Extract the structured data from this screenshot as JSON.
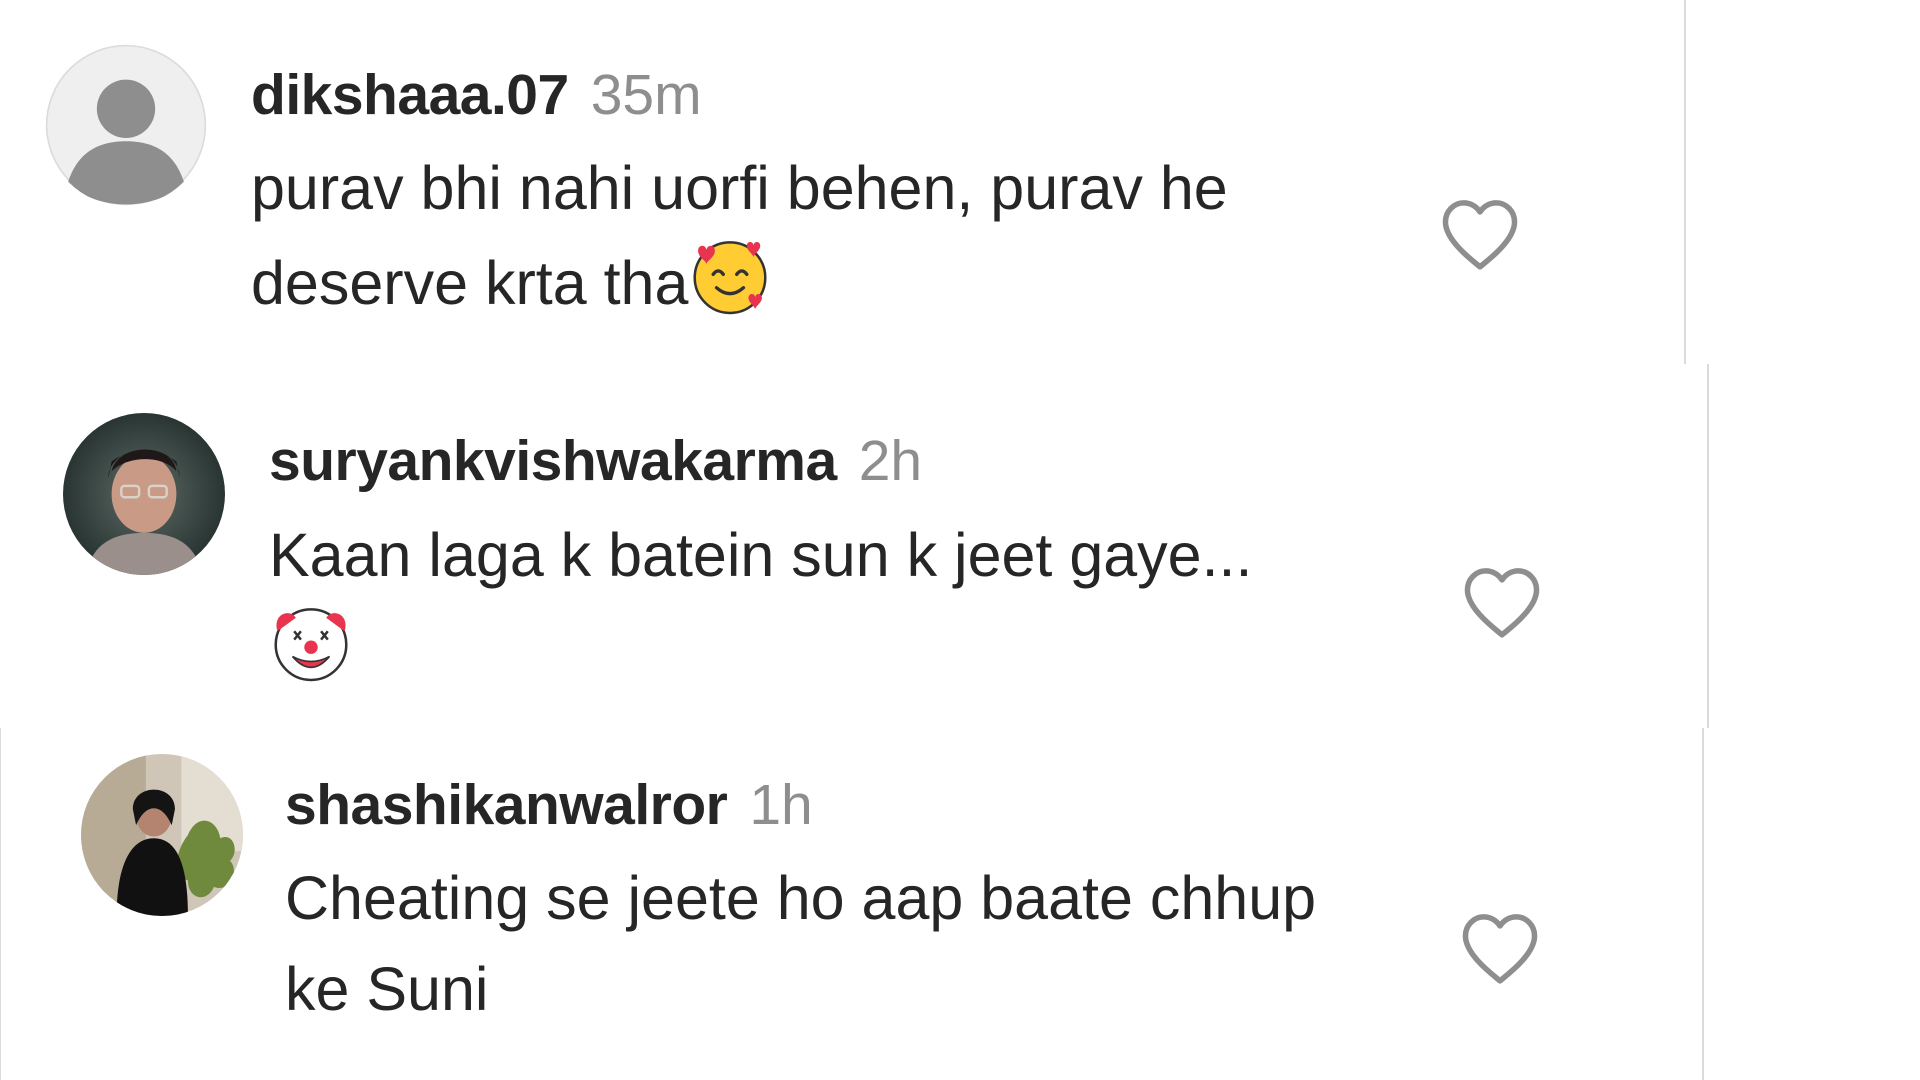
{
  "comments": [
    {
      "username": "dikshaaa.07",
      "time": "35m",
      "text": "purav bhi nahi uorfi behen, purav he deserve krta tha",
      "emoji": "smiling-face-with-hearts-emoji",
      "avatar": "default-user-avatar"
    },
    {
      "username": "suryankvishwakarma",
      "time": "2h",
      "text": "Kaan laga k batein sun k jeet gaye...",
      "emoji": "clown-face-emoji",
      "avatar": "user-photo-avatar"
    },
    {
      "username": "shashikanwalror",
      "time": "1h",
      "text": "Cheating se jeete ho aap baate chhup ke Suni",
      "avatar": "user-photo-avatar"
    }
  ],
  "icons": {
    "like": "heart-outline-icon"
  },
  "colors": {
    "username": "#262626",
    "timestamp": "#8e8e8e",
    "text": "#262626",
    "divider": "#dbdbdb",
    "heart_outline": "#8e8e8e"
  }
}
